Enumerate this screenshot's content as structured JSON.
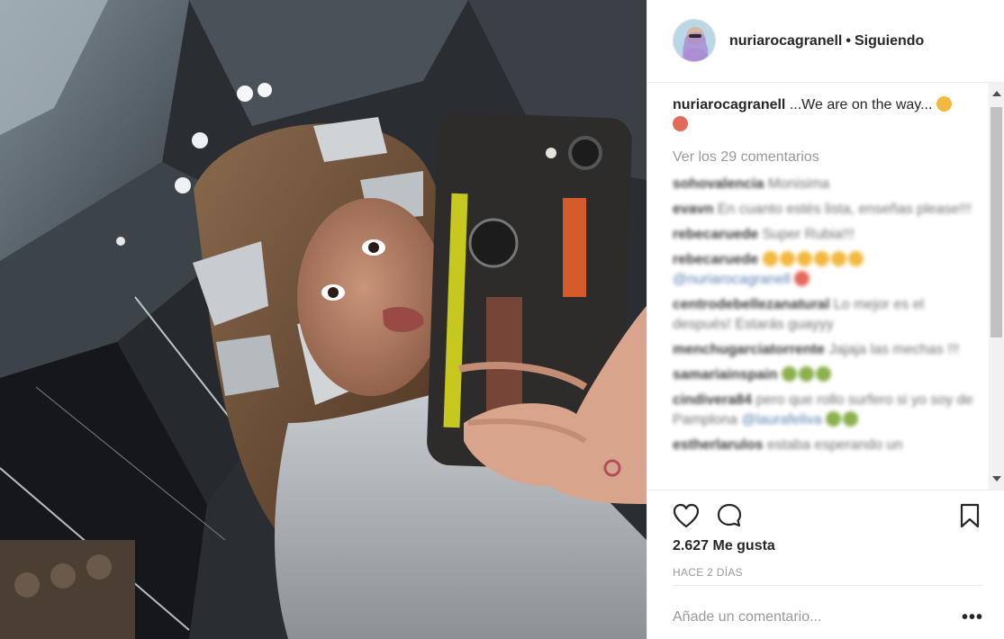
{
  "post": {
    "username": "nuriarocagranell",
    "follow_status": "Siguiendo",
    "separator": "•",
    "caption_user": "nuriarocagranell",
    "caption_text": "...We are on the way...",
    "view_all_comments": "Ver los 29 comentarios",
    "likes": "2.627 Me gusta",
    "date": "HACE 2 DÍAS",
    "add_comment_placeholder": "Añade un comentario...",
    "more_options": "•••"
  },
  "comments": [
    {
      "user": "sohovalencia",
      "text": "Monisima"
    },
    {
      "user": "evavn",
      "text": "En cuanto estés lista, enseñas please!!!"
    },
    {
      "user": "rebecaruede",
      "text": "Super Rubia!!!"
    },
    {
      "user": "rebecaruede",
      "text": "",
      "mention": "@nuriarocagranell"
    },
    {
      "user": "centrodebellezanatural",
      "text": "Lo mejor es el después! Estarás guayyy"
    },
    {
      "user": "menchugarciatorrente",
      "text": "Jajaja las mechas !!!"
    },
    {
      "user": "samariainspain",
      "text": ""
    },
    {
      "user": "cindivera84",
      "text": "pero que rollo surfero si yo soy de Pamplona",
      "mention": "@laurafeliva"
    },
    {
      "user": "estherlarulos",
      "text": "estaba esperando un"
    }
  ],
  "icons": {
    "like": "heart-icon",
    "comment": "comment-icon",
    "save": "bookmark-icon"
  },
  "colors": {
    "text": "#262626",
    "muted": "#999999",
    "border": "#efefef"
  }
}
